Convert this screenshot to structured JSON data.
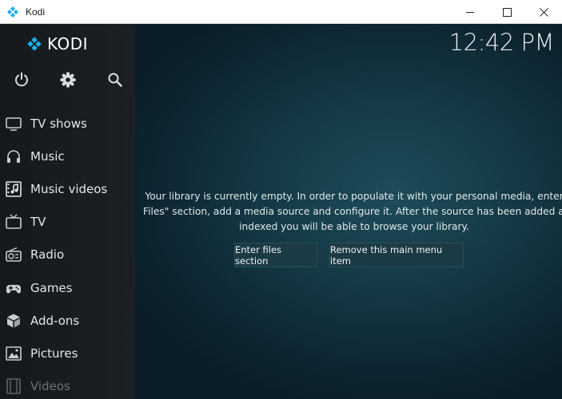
{
  "window": {
    "title": "Kodi",
    "icon": "kodi-logo-icon",
    "controls": [
      "minimize-icon",
      "maximize-icon",
      "close-icon"
    ]
  },
  "sidebar": {
    "logo_text": "KODI",
    "top_icons": [
      "power-icon",
      "gear-icon",
      "search-icon"
    ],
    "items": [
      {
        "label": "TV shows",
        "icon": "tv-icon"
      },
      {
        "label": "Music",
        "icon": "headphones-icon"
      },
      {
        "label": "Music videos",
        "icon": "music-video-icon"
      },
      {
        "label": "TV",
        "icon": "live-tv-icon"
      },
      {
        "label": "Radio",
        "icon": "radio-icon"
      },
      {
        "label": "Games",
        "icon": "gamepad-icon"
      },
      {
        "label": "Add-ons",
        "icon": "box-icon"
      },
      {
        "label": "Pictures",
        "icon": "picture-icon"
      },
      {
        "label": "Videos",
        "icon": "film-icon"
      }
    ]
  },
  "main": {
    "clock": "12:42 PM",
    "message_lines": [
      "Your library is currently empty. In order to populate it with your personal media, enter",
      "Files\" section, add a media source and configure it. After the source has been added an",
      "indexed you will be able to browse your library."
    ],
    "buttons": {
      "enter_files": "Enter files section",
      "remove_item": "Remove this main menu item"
    }
  },
  "colors": {
    "accent": "#17b2e7",
    "sidebar_bg": "#181c1f",
    "main_bg": "#143844"
  }
}
